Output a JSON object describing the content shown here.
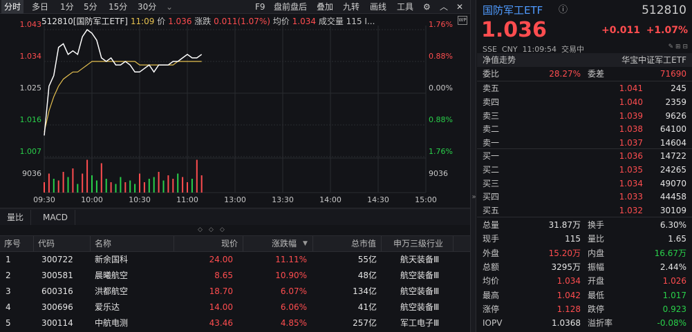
{
  "toolbar": {
    "tabs": [
      "分时",
      "多日",
      "1分",
      "5分",
      "15分",
      "30分"
    ],
    "right": [
      "F9",
      "盘前盘后",
      "叠加",
      "九转",
      "画线",
      "工具"
    ]
  },
  "info": {
    "code_name": "512810[国防军工ETF]",
    "time": "11:09",
    "price_label": "价",
    "price": "1.036",
    "chg_label": "涨跌",
    "chg": "0.011(1.07%)",
    "avg_label": "均价",
    "avg": "1.034",
    "vol_label": "成交量",
    "vol": "115",
    "trunc": "I...",
    "wp": "WP"
  },
  "axis": {
    "left": [
      "1.043",
      "1.034",
      "1.025",
      "1.016",
      "1.007",
      "9036"
    ],
    "right": [
      "1.76%",
      "0.88%",
      "0.00%",
      "0.88%",
      "1.76%",
      "9036"
    ],
    "times": [
      "09:30",
      "10:00",
      "10:30",
      "11:00",
      "13:00",
      "13:30",
      "14:00",
      "14:30",
      "15:00"
    ]
  },
  "chart_data": {
    "type": "line",
    "title": "512810[国防军工ETF]",
    "ylim": [
      1.007,
      1.043
    ],
    "prev_close": 1.025,
    "x": [
      "09:30",
      "09:33",
      "09:36",
      "09:39",
      "09:42",
      "09:45",
      "09:48",
      "09:51",
      "09:54",
      "09:57",
      "10:00",
      "10:03",
      "10:06",
      "10:09",
      "10:12",
      "10:15",
      "10:18",
      "10:21",
      "10:24",
      "10:27",
      "10:30",
      "10:33",
      "10:36",
      "10:39",
      "10:42",
      "10:45",
      "10:48",
      "10:51",
      "10:54",
      "10:57",
      "11:00",
      "11:03",
      "11:06",
      "11:09"
    ],
    "series": [
      {
        "values": [
          1.013,
          1.027,
          1.03,
          1.038,
          1.039,
          1.036,
          1.037,
          1.036,
          1.041,
          1.043,
          1.042,
          1.04,
          1.035,
          1.034,
          1.035,
          1.033,
          1.033,
          1.034,
          1.033,
          1.031,
          1.031,
          1.032,
          1.033,
          1.031,
          1.033,
          1.033,
          1.033,
          1.034,
          1.034,
          1.035,
          1.036,
          1.035,
          1.035,
          1.036
        ]
      },
      {
        "values": [
          1.014,
          1.02,
          1.024,
          1.027,
          1.029,
          1.03,
          1.031,
          1.031,
          1.032,
          1.033,
          1.034,
          1.034,
          1.034,
          1.034,
          1.034,
          1.034,
          1.034,
          1.034,
          1.034,
          1.034,
          1.033,
          1.033,
          1.033,
          1.033,
          1.033,
          1.033,
          1.033,
          1.033,
          1.034,
          1.034,
          1.034,
          1.034,
          1.034,
          1.034
        ]
      }
    ],
    "volume": [
      0.3,
      0.55,
      0.4,
      0.35,
      0.6,
      0.45,
      0.7,
      0.25,
      0.55,
      0.95,
      0.5,
      0.35,
      0.85,
      0.4,
      0.3,
      0.25,
      0.45,
      0.3,
      0.35,
      0.25,
      0.55,
      0.3,
      0.4,
      0.45,
      0.6,
      0.35,
      0.5,
      0.4,
      0.55,
      0.45,
      0.3,
      0.4,
      0.95,
      0.5
    ],
    "volume_up": [
      1,
      1,
      0,
      1,
      1,
      0,
      1,
      0,
      1,
      1,
      0,
      0,
      1,
      0,
      1,
      0,
      0,
      1,
      0,
      0,
      1,
      1,
      0,
      0,
      1,
      0,
      1,
      1,
      0,
      1,
      1,
      0,
      1,
      1
    ]
  },
  "subtabs": [
    "量比",
    "MACD"
  ],
  "table": {
    "headers": [
      "序号",
      "代码",
      "名称",
      "现价",
      "涨跌幅",
      "总市值",
      "申万三级行业"
    ],
    "rows": [
      [
        "1",
        "300722",
        "新余国科",
        "24.00",
        "11.11%",
        "55亿",
        "航天装备Ⅲ"
      ],
      [
        "2",
        "300581",
        "晨曦航空",
        "8.65",
        "10.90%",
        "48亿",
        "航空装备Ⅲ"
      ],
      [
        "3",
        "600316",
        "洪都航空",
        "18.70",
        "6.07%",
        "134亿",
        "航空装备Ⅲ"
      ],
      [
        "4",
        "300696",
        "爱乐达",
        "14.00",
        "6.06%",
        "41亿",
        "航空装备Ⅲ"
      ],
      [
        "5",
        "300114",
        "中航电测",
        "43.46",
        "4.85%",
        "257亿",
        "军工电子Ⅲ"
      ]
    ]
  },
  "quote": {
    "name": "国防军工ETF",
    "code": "512810",
    "price": "1.036",
    "chg": "+0.011",
    "pct": "+1.07%",
    "market": "SSE",
    "currency": "CNY",
    "time": "11:09:54",
    "status": "交易中",
    "nav_label": "净值走势",
    "index_label": "华宝中证军工ETF",
    "wb_label": "委比",
    "wb": "28.27%",
    "wc_label": "委差",
    "wc": "71690",
    "asks": [
      [
        "卖五",
        "1.041",
        "245"
      ],
      [
        "卖四",
        "1.040",
        "2359"
      ],
      [
        "卖三",
        "1.039",
        "9626"
      ],
      [
        "卖二",
        "1.038",
        "64100"
      ],
      [
        "卖一",
        "1.037",
        "14604"
      ]
    ],
    "bids": [
      [
        "买一",
        "1.036",
        "14722"
      ],
      [
        "买二",
        "1.035",
        "24265"
      ],
      [
        "买三",
        "1.034",
        "49070"
      ],
      [
        "买四",
        "1.033",
        "44458"
      ],
      [
        "买五",
        "1.032",
        "30109"
      ]
    ],
    "stats": [
      [
        "总量",
        "31.87万",
        "换手",
        "6.30%"
      ],
      [
        "现手",
        "115",
        "量比",
        "1.65"
      ],
      [
        "外盘",
        "15.20万",
        "内盘",
        "16.67万"
      ],
      [
        "总额",
        "3295万",
        "振幅",
        "2.44%"
      ],
      [
        "均价",
        "1.034",
        "开盘",
        "1.026"
      ],
      [
        "最高",
        "1.042",
        "最低",
        "1.017"
      ],
      [
        "涨停",
        "1.128",
        "跌停",
        "0.923"
      ],
      [
        "IOPV",
        "1.0368",
        "溢折率",
        "-0.08%"
      ]
    ]
  },
  "colors": {
    "up": "#ff4d4f",
    "down": "#29d04a",
    "avg": "#e6c150",
    "price": "#ffffff"
  }
}
